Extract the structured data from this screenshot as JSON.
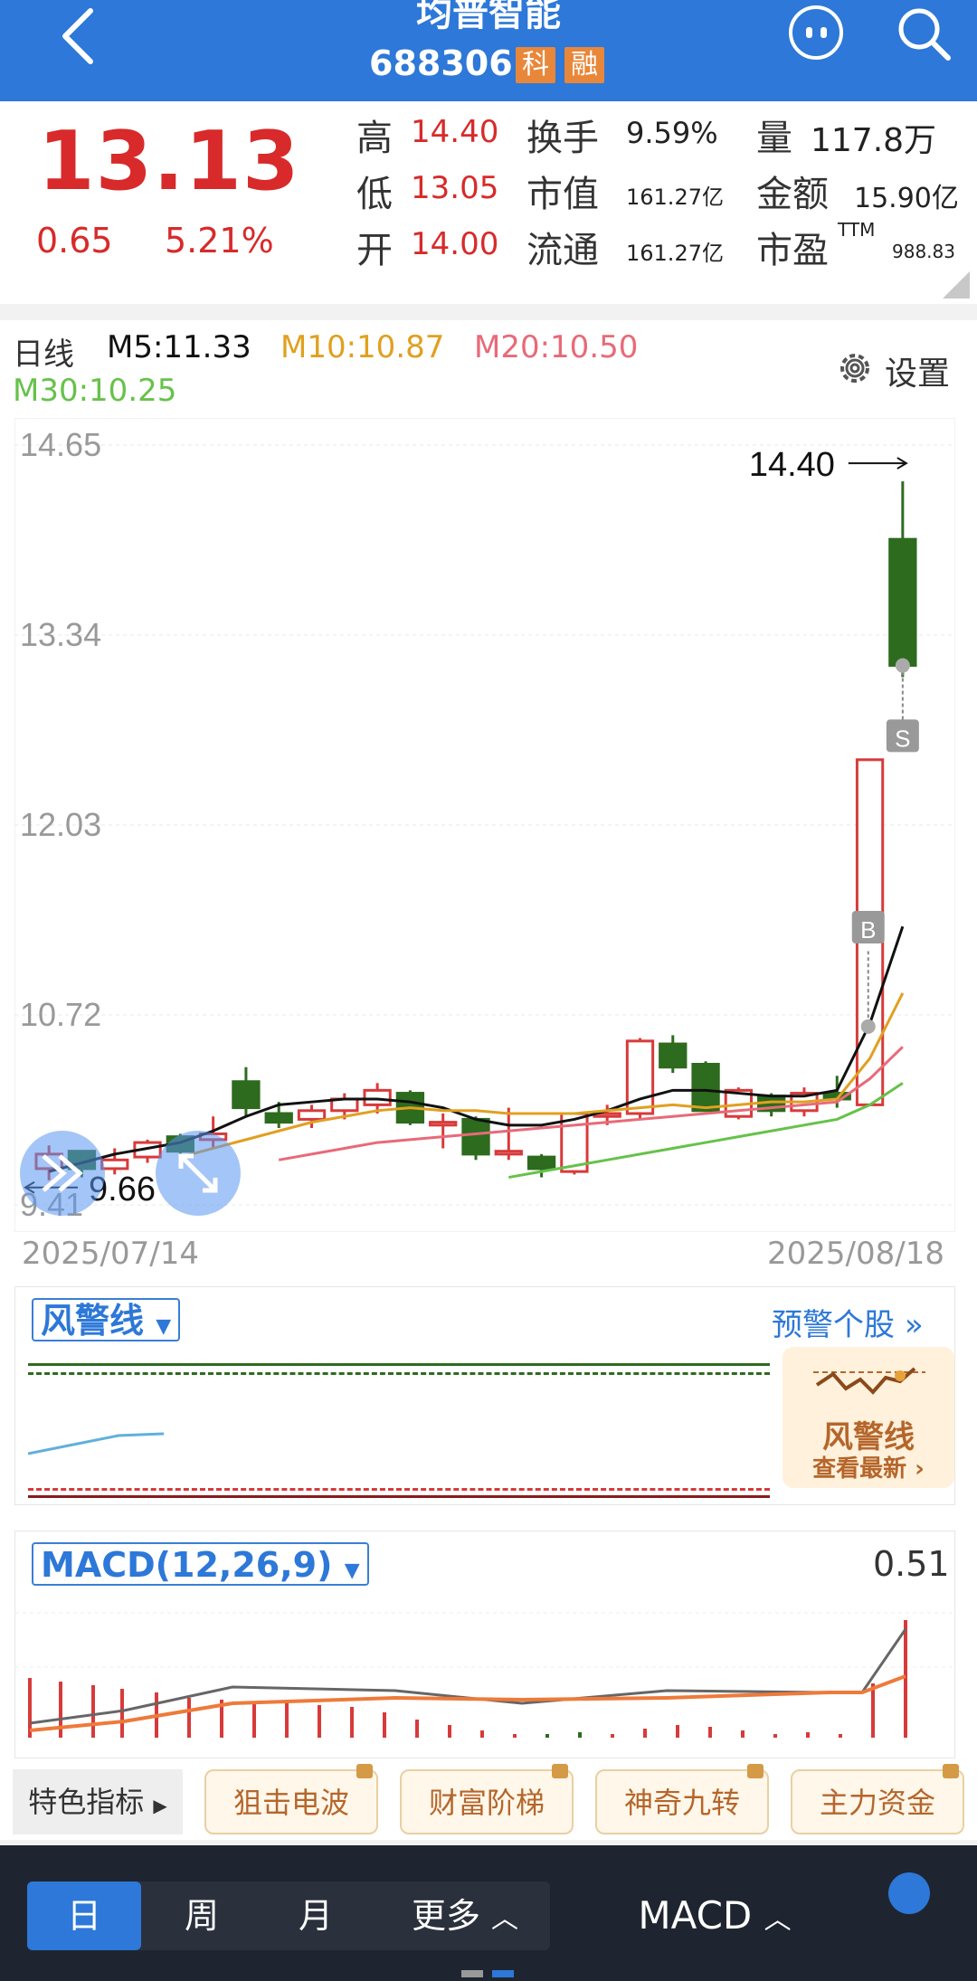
{
  "header": {
    "title": "均普智能",
    "code": "688306",
    "tag_ke": "科",
    "tag_rong": "融"
  },
  "quote": {
    "price": "13.13",
    "change": "0.65",
    "change_pct": "5.21%",
    "high_label": "高",
    "high": "14.40",
    "low_label": "低",
    "low": "13.05",
    "open_label": "开",
    "open": "14.00",
    "turnover_label": "换手",
    "turnover": "9.59%",
    "mktcap_label": "市值",
    "mktcap": "161.27亿",
    "float_label": "流通",
    "float_cap": "161.27亿",
    "volume_label": "量",
    "volume": "117.8万",
    "amount_label": "金额",
    "amount": "15.90亿",
    "pe_label": "市盈",
    "pe_sup": "TTM",
    "pe": "988.83"
  },
  "ma_legend": {
    "period": "日线",
    "m5": "M5:11.33",
    "m10": "M10:10.87",
    "m20": "M20:10.50",
    "m30": "M30:10.25",
    "settings": "设置"
  },
  "colors": {
    "up": "#d83a3a",
    "down": "#2d6b1e",
    "m5": "#111111",
    "m10": "#e0a020",
    "m20": "#e86a78",
    "m30": "#66c24a",
    "brand": "#2d78d8"
  },
  "chart_data": {
    "type": "candlestick",
    "x_start": "2025/07/14",
    "x_end": "2025/08/18",
    "y_ticks": [
      "14.65",
      "13.34",
      "12.03",
      "10.72",
      "9.41"
    ],
    "ylim": [
      9.41,
      14.65
    ],
    "high_marker": "14.40",
    "low_marker": "9.66",
    "buy_marker": "B",
    "sell_marker": "S",
    "candles": [
      {
        "o": 9.66,
        "h": 9.82,
        "l": 9.58,
        "c": 9.76
      },
      {
        "o": 9.78,
        "h": 9.78,
        "l": 9.6,
        "c": 9.66
      },
      {
        "o": 9.66,
        "h": 9.8,
        "l": 9.62,
        "c": 9.72
      },
      {
        "o": 9.74,
        "h": 9.86,
        "l": 9.7,
        "c": 9.84
      },
      {
        "o": 9.88,
        "h": 9.9,
        "l": 9.72,
        "c": 9.78
      },
      {
        "o": 9.86,
        "h": 10.02,
        "l": 9.8,
        "c": 9.9
      },
      {
        "o": 10.26,
        "h": 10.36,
        "l": 10.02,
        "c": 10.08
      },
      {
        "o": 10.04,
        "h": 10.12,
        "l": 9.94,
        "c": 9.98
      },
      {
        "o": 10.0,
        "h": 10.1,
        "l": 9.94,
        "c": 10.06
      },
      {
        "o": 10.06,
        "h": 10.18,
        "l": 10.0,
        "c": 10.14
      },
      {
        "o": 10.1,
        "h": 10.25,
        "l": 10.04,
        "c": 10.2
      },
      {
        "o": 10.18,
        "h": 10.2,
        "l": 9.96,
        "c": 9.98
      },
      {
        "o": 9.96,
        "h": 10.04,
        "l": 9.8,
        "c": 9.98
      },
      {
        "o": 10.0,
        "h": 10.02,
        "l": 9.72,
        "c": 9.76
      },
      {
        "o": 9.76,
        "h": 10.08,
        "l": 9.72,
        "c": 9.78
      },
      {
        "o": 9.74,
        "h": 9.76,
        "l": 9.6,
        "c": 9.66
      },
      {
        "o": 9.64,
        "h": 10.04,
        "l": 9.62,
        "c": 10.04
      },
      {
        "o": 10.02,
        "h": 10.1,
        "l": 9.96,
        "c": 10.04
      },
      {
        "o": 10.04,
        "h": 10.56,
        "l": 10.0,
        "c": 10.54
      },
      {
        "o": 10.52,
        "h": 10.58,
        "l": 10.32,
        "c": 10.36
      },
      {
        "o": 10.38,
        "h": 10.4,
        "l": 10.06,
        "c": 10.06
      },
      {
        "o": 10.02,
        "h": 10.22,
        "l": 10.0,
        "c": 10.2
      },
      {
        "o": 10.16,
        "h": 10.18,
        "l": 10.02,
        "c": 10.06
      },
      {
        "o": 10.06,
        "h": 10.22,
        "l": 10.02,
        "c": 10.18
      },
      {
        "o": 10.18,
        "h": 10.3,
        "l": 10.08,
        "c": 10.14
      },
      {
        "o": 10.1,
        "h": 12.48,
        "l": 10.1,
        "c": 12.48
      },
      {
        "o": 14.0,
        "h": 14.4,
        "l": 13.05,
        "c": 13.13
      }
    ],
    "series": [
      {
        "name": "M5",
        "values": [
          9.64,
          9.7,
          9.76,
          9.8,
          9.84,
          9.92,
          10.02,
          10.1,
          10.12,
          10.14,
          10.14,
          10.12,
          10.08,
          10.0,
          9.96,
          9.96,
          10.0,
          10.06,
          10.14,
          10.2,
          10.2,
          10.18,
          10.16,
          10.16,
          10.2,
          10.66,
          11.33
        ]
      },
      {
        "name": "M10",
        "values": [
          null,
          null,
          null,
          null,
          9.74,
          9.8,
          9.86,
          9.92,
          9.98,
          10.02,
          10.06,
          10.08,
          10.06,
          10.06,
          10.04,
          10.04,
          10.04,
          10.06,
          10.08,
          10.1,
          10.08,
          10.1,
          10.12,
          10.12,
          10.14,
          10.42,
          10.87
        ]
      },
      {
        "name": "M20",
        "values": [
          null,
          null,
          null,
          null,
          null,
          null,
          null,
          9.72,
          9.76,
          9.8,
          9.84,
          9.86,
          9.88,
          9.9,
          9.92,
          9.94,
          9.96,
          9.98,
          10.0,
          10.02,
          10.04,
          10.06,
          10.08,
          10.1,
          10.12,
          10.28,
          10.5
        ]
      },
      {
        "name": "M30",
        "values": [
          null,
          null,
          null,
          null,
          null,
          null,
          null,
          null,
          null,
          null,
          null,
          null,
          null,
          null,
          9.6,
          9.64,
          9.68,
          9.72,
          9.76,
          9.8,
          9.84,
          9.88,
          9.92,
          9.96,
          10.0,
          10.1,
          10.25
        ]
      }
    ]
  },
  "warning": {
    "select_label": "风警线",
    "link_label": "预警个股",
    "promo_title": "风警线",
    "promo_sub": "查看最新 ›"
  },
  "macd": {
    "select_label": "MACD(12,26,9)",
    "value": "0.51"
  },
  "feature_chips": {
    "label": "特色指标",
    "items": [
      "狙击电波",
      "财富阶梯",
      "神奇九转",
      "主力资金"
    ]
  },
  "bottom_tabs": {
    "day": "日",
    "week": "周",
    "month": "月",
    "more": "更多",
    "indicator": "MACD"
  }
}
